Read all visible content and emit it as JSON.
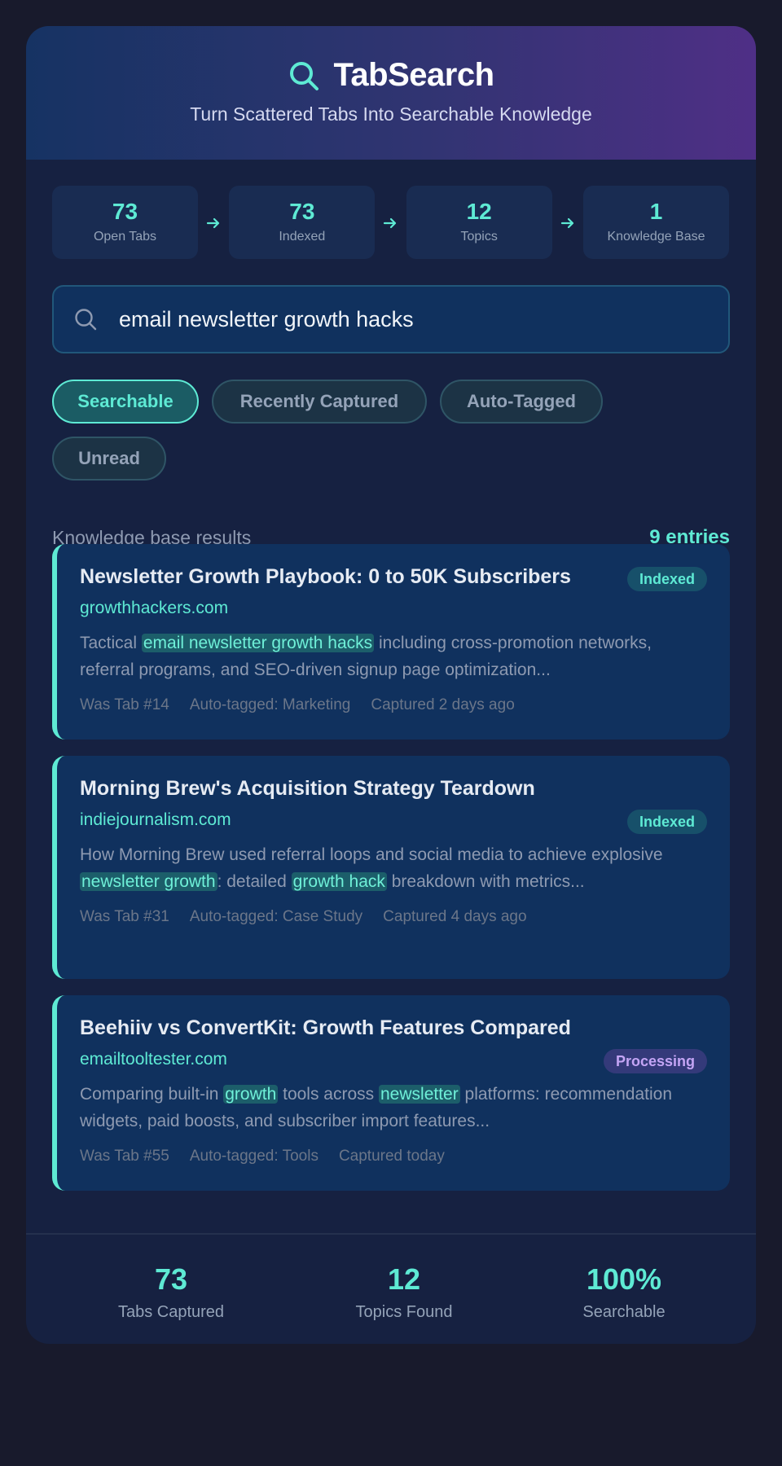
{
  "app": {
    "title": "TabSearch",
    "tagline": "Turn Scattered Tabs Into Searchable Knowledge",
    "icon": "search-icon",
    "accent_color": "#5eead4"
  },
  "pipeline": [
    {
      "value": "73",
      "label": "Open Tabs"
    },
    {
      "value": "73",
      "label": "Indexed"
    },
    {
      "value": "12",
      "label": "Topics"
    },
    {
      "value": "1",
      "label": "Knowledge Base"
    }
  ],
  "search": {
    "value": "email newsletter growth hacks",
    "icon": "search-icon"
  },
  "filters": [
    {
      "label": "Searchable",
      "active": true
    },
    {
      "label": "Recently Captured",
      "active": false
    },
    {
      "label": "Auto-Tagged",
      "active": false
    },
    {
      "label": "Unread",
      "active": false
    }
  ],
  "results_header": {
    "label": "Knowledge base results",
    "count": "9 entries"
  },
  "results": [
    {
      "title": "Newsletter Growth Playbook: 0 to 50K Subscribers",
      "domain": "growthhackers.com",
      "status": "Indexed",
      "snippet": [
        "Tactical ",
        "email newsletter growth hacks",
        " including cross-promotion networks, referral programs, and SEO-driven signup page optimization..."
      ],
      "tab": "Was Tab #14",
      "tag": "Auto-tagged: Marketing",
      "captured": "Captured 2 days ago"
    },
    {
      "title": "Morning Brew's Acquisition Strategy Teardown",
      "domain": "indiejournalism.com",
      "status": "Indexed",
      "snippet": [
        "How Morning Brew used referral loops and social media to achieve explosive ",
        "newsletter growth",
        ": detailed ",
        "growth hack",
        " breakdown with metrics..."
      ],
      "tab": "Was Tab #31",
      "tag": "Auto-tagged: Case Study",
      "captured": "Captured 4 days ago"
    },
    {
      "title": "Beehiiv vs ConvertKit: Growth Features Compared",
      "domain": "emailtooltester.com",
      "status": "Processing",
      "snippet": [
        "Comparing built-in ",
        "growth",
        " tools across ",
        "newsletter",
        " platforms: recommendation widgets, paid boosts, and subscriber import features..."
      ],
      "tab": "Was Tab #55",
      "tag": "Auto-tagged: Tools",
      "captured": "Captured today"
    }
  ],
  "footer": [
    {
      "value": "73",
      "label": "Tabs Captured"
    },
    {
      "value": "12",
      "label": "Topics Found"
    },
    {
      "value": "100%",
      "label": "Searchable"
    }
  ]
}
